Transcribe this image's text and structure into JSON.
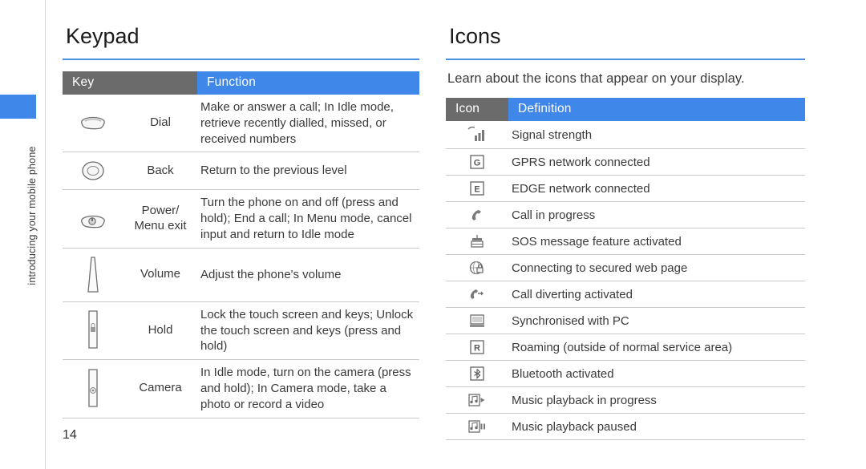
{
  "side_label": "introducing your mobile phone",
  "page_number": "14",
  "left": {
    "title": "Keypad",
    "headers": {
      "key": "Key",
      "function": "Function"
    },
    "rows": [
      {
        "icon": "dial-key-icon",
        "name": "Dial",
        "function": "Make or answer a call; In Idle mode, retrieve recently dialled, missed, or received numbers"
      },
      {
        "icon": "back-key-icon",
        "name": "Back",
        "function": "Return to the previous level"
      },
      {
        "icon": "power-menu-exit-key-icon",
        "name": "Power/\nMenu exit",
        "function": "Turn the phone on and off (press and hold); End a call; In Menu mode, cancel input and return to Idle mode"
      },
      {
        "icon": "volume-key-icon",
        "name": "Volume",
        "function": "Adjust the phone's volume"
      },
      {
        "icon": "hold-key-icon",
        "name": "Hold",
        "function": "Lock the touch screen and keys; Unlock the touch screen and keys (press and hold)"
      },
      {
        "icon": "camera-key-icon",
        "name": "Camera",
        "function": "In Idle mode, turn on the camera (press and hold); In Camera mode, take a photo or record a video"
      }
    ]
  },
  "right": {
    "title": "Icons",
    "intro": "Learn about the icons that appear on your display.",
    "headers": {
      "icon": "Icon",
      "definition": "Definition"
    },
    "rows": [
      {
        "icon": "signal-strength-icon",
        "definition": "Signal strength"
      },
      {
        "icon": "gprs-network-icon",
        "definition": "GPRS network connected"
      },
      {
        "icon": "edge-network-icon",
        "definition": "EDGE network connected"
      },
      {
        "icon": "call-in-progress-icon",
        "definition": "Call in progress"
      },
      {
        "icon": "sos-message-icon",
        "definition": "SOS message feature activated"
      },
      {
        "icon": "secured-web-page-icon",
        "definition": "Connecting to secured web page"
      },
      {
        "icon": "call-diverting-icon",
        "definition": "Call diverting activated"
      },
      {
        "icon": "synchronised-pc-icon",
        "definition": "Synchronised with PC"
      },
      {
        "icon": "roaming-icon",
        "definition": "Roaming (outside of normal service area)"
      },
      {
        "icon": "bluetooth-icon",
        "definition": "Bluetooth activated"
      },
      {
        "icon": "music-playback-icon",
        "definition": "Music playback in progress"
      },
      {
        "icon": "music-paused-icon",
        "definition": "Music playback paused"
      }
    ]
  },
  "colors": {
    "accent": "#3f87e8",
    "header_dark": "#6b6b6b",
    "text": "#3a3a3a"
  }
}
